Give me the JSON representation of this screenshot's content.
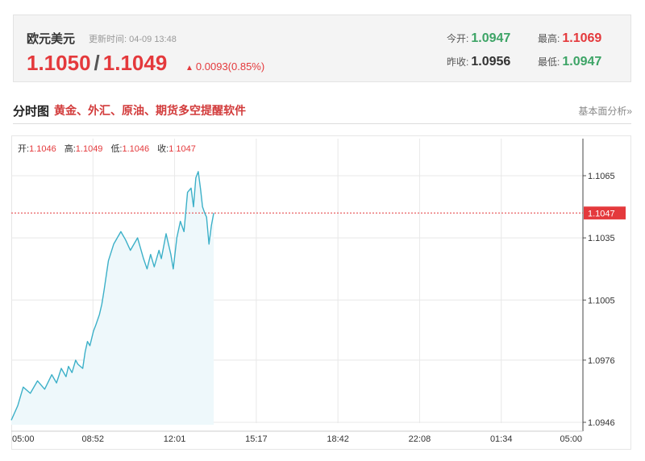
{
  "quote": {
    "name": "欧元美元",
    "update_label": "更新时间:",
    "update_time": "04-09 13:48",
    "bid": "1.1050",
    "separator": "/",
    "ask": "1.1049",
    "change_arrow": "▲",
    "change": "0.0093(0.85%)",
    "stats": {
      "open_label": "今开:",
      "open": "1.0947",
      "high_label": "最高:",
      "high": "1.1069",
      "prev_close_label": "昨收:",
      "prev_close": "1.0956",
      "low_label": "最低:",
      "low": "1.0947"
    }
  },
  "section": {
    "title": "分时图",
    "promo": "黄金、外汇、原油、期货多空提醒软件",
    "link": "基本面分析»"
  },
  "ohlc_bar": {
    "open_label": "开:",
    "open": "1.1046",
    "high_label": "高:",
    "high": "1.1049",
    "low_label": "低:",
    "low": "1.1046",
    "close_label": "收:",
    "close": "1.1047"
  },
  "colors": {
    "line": "#3cb0c8",
    "fill": "#eef8fb",
    "current_line": "#e4393c",
    "current_label_bg": "#e4393c",
    "grid": "#e8e8e8"
  },
  "chart_data": {
    "type": "area",
    "x_ticks": [
      "05:00",
      "08:52",
      "12:01",
      "15:17",
      "18:42",
      "22:08",
      "01:34",
      "05:00"
    ],
    "y_ticks": [
      "1.1065",
      "1.1035",
      "1.1005",
      "1.0976",
      "1.0946"
    ],
    "ylim": [
      1.0946,
      1.1065
    ],
    "current_price": "1.1047",
    "current_value": 1.1047,
    "grid": true,
    "x_hours": [
      0,
      0.27,
      0.5,
      0.8,
      1.1,
      1.4,
      1.7,
      1.9,
      2.1,
      2.3,
      2.4,
      2.55,
      2.7,
      2.8,
      3.0,
      3.1,
      3.2,
      3.3,
      3.45,
      3.55,
      3.7,
      3.8,
      3.9,
      4.0,
      4.08,
      4.3,
      4.6,
      4.8,
      5.0,
      5.3,
      5.55,
      5.7,
      5.85,
      6.0,
      6.2,
      6.3,
      6.5,
      6.7,
      6.8,
      6.95,
      7.1,
      7.25,
      7.4,
      7.55,
      7.65,
      7.75,
      7.85,
      7.95,
      8.03,
      8.12,
      8.2,
      8.3,
      8.4,
      8.5
    ],
    "values": [
      1.0947,
      1.0954,
      1.0963,
      1.096,
      1.0966,
      1.0962,
      1.0969,
      1.0965,
      1.0972,
      1.0968,
      1.0973,
      1.097,
      1.0976,
      1.0974,
      1.0972,
      1.098,
      1.0985,
      1.0983,
      1.099,
      1.0993,
      1.0998,
      1.1003,
      1.101,
      1.1018,
      1.1024,
      1.1032,
      1.1038,
      1.1034,
      1.1029,
      1.1035,
      1.1025,
      1.102,
      1.1027,
      1.1021,
      1.1029,
      1.1025,
      1.1037,
      1.1027,
      1.102,
      1.1035,
      1.1043,
      1.1038,
      1.1057,
      1.1059,
      1.105,
      1.1064,
      1.1067,
      1.1058,
      1.105,
      1.1047,
      1.1045,
      1.1032,
      1.1041,
      1.1047
    ]
  }
}
